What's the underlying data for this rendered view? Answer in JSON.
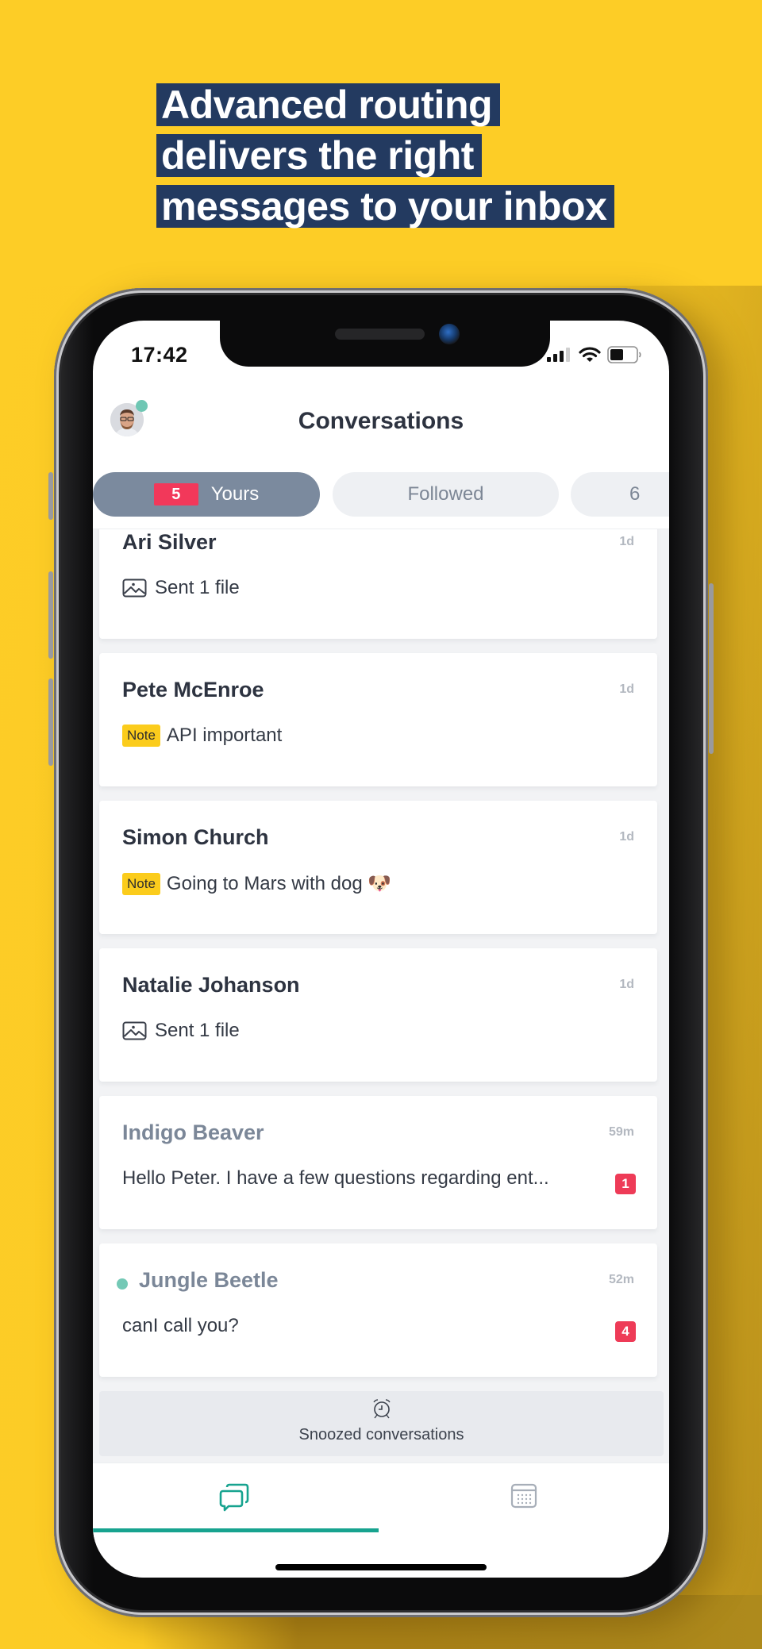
{
  "headline": {
    "lines": [
      "Advanced routing",
      "delivers the right",
      "messages to your inbox"
    ]
  },
  "status_bar": {
    "time": "17:42",
    "icons": [
      "signal-icon",
      "wifi-icon",
      "battery-icon"
    ],
    "battery_level": 0.5
  },
  "header": {
    "title": "Conversations",
    "avatar_status": "online"
  },
  "tabs": [
    {
      "label": "Yours",
      "count": "5",
      "active": true
    },
    {
      "label": "Followed",
      "count": null,
      "active": false
    },
    {
      "label": "6",
      "count": null,
      "active": false
    }
  ],
  "conversations": [
    {
      "name": "Ari Silver",
      "time": "1d",
      "type": "file",
      "message": "Sent 1 file",
      "unread": null,
      "online": false,
      "muted_name": false
    },
    {
      "name": "Pete McEnroe",
      "time": "1d",
      "type": "note",
      "note_label": "Note",
      "message": "API important",
      "unread": null,
      "online": false,
      "muted_name": false
    },
    {
      "name": "Simon Church",
      "time": "1d",
      "type": "note",
      "note_label": "Note",
      "message": "Going to Mars with dog 🐶",
      "unread": null,
      "online": false,
      "muted_name": false
    },
    {
      "name": "Natalie Johanson",
      "time": "1d",
      "type": "file",
      "message": "Sent 1 file",
      "unread": null,
      "online": false,
      "muted_name": false
    },
    {
      "name": "Indigo Beaver",
      "time": "59m",
      "type": "text",
      "message": "Hello Peter. I have a few questions regarding ent...",
      "unread": "1",
      "online": false,
      "muted_name": true
    },
    {
      "name": "Jungle Beetle",
      "time": "52m",
      "type": "text",
      "message": "canI call you?",
      "unread": "4",
      "online": true,
      "muted_name": true
    }
  ],
  "snoozed": {
    "label": "Snoozed conversations",
    "icon": "alarm-clock-icon"
  },
  "tabbar": {
    "items": [
      {
        "name": "conversations",
        "icon": "chat-bubbles-icon",
        "active": true
      },
      {
        "name": "calendar",
        "icon": "calendar-icon",
        "active": false
      }
    ]
  },
  "colors": {
    "background": "#fdcd26",
    "headline_bg": "#233a60",
    "active_tab": "#7b8a9e",
    "badge_red": "#ee3b57",
    "note_yellow": "#fbcc1c",
    "accent_teal": "#17a38f",
    "online_green": "#74c9b6"
  }
}
